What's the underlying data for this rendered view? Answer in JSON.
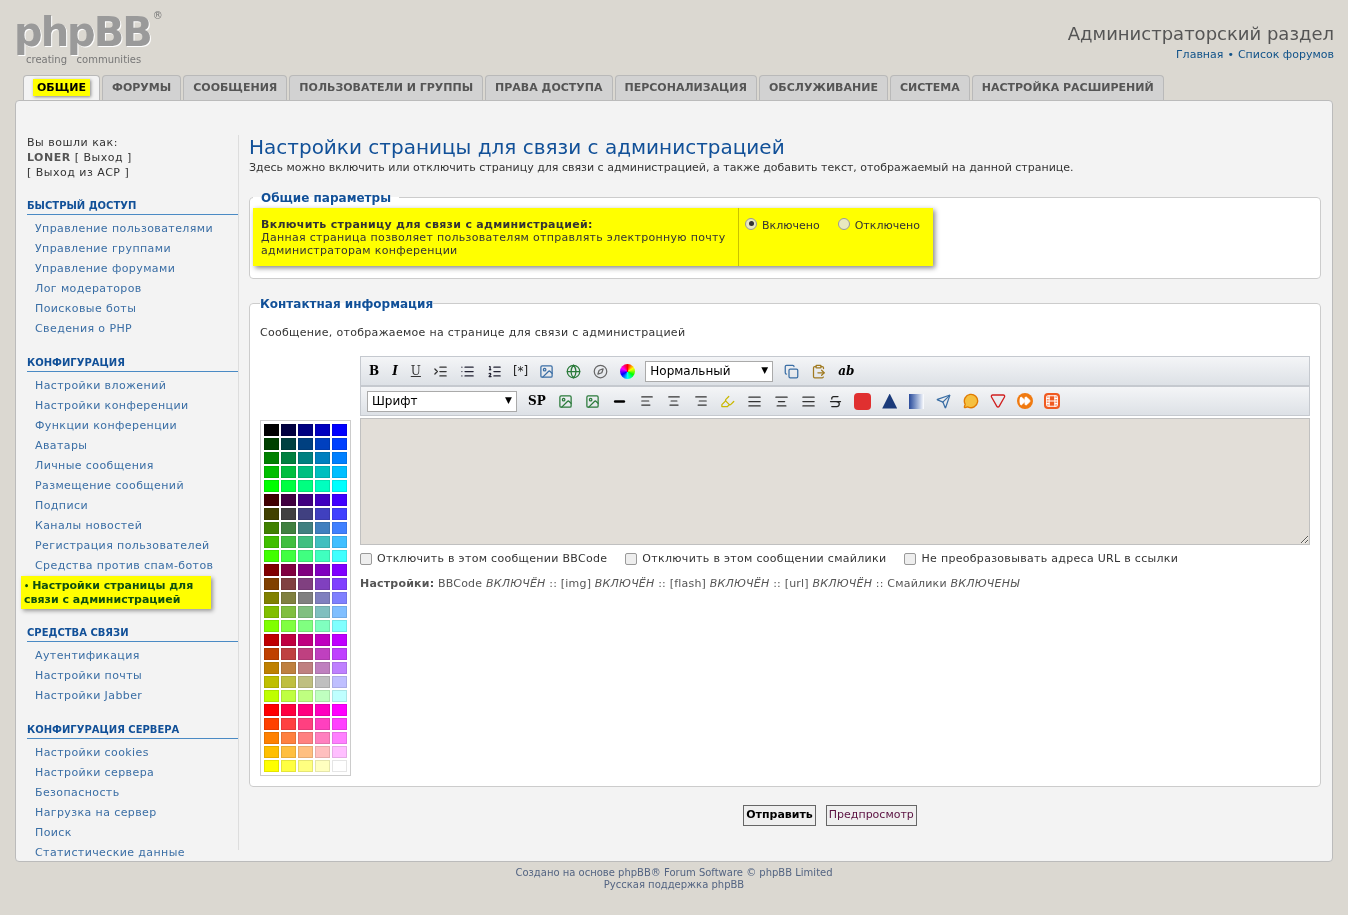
{
  "logo": {
    "name": "phpBB",
    "mark": "®",
    "tagline": "creating   communities"
  },
  "header": {
    "title": "Администраторский раздел",
    "links": [
      {
        "label": "Главная"
      },
      {
        "label": "Список форумов"
      }
    ],
    "separator": "•"
  },
  "tabs": [
    {
      "label": "ОБЩИЕ",
      "selected": true
    },
    {
      "label": "ФОРУМЫ",
      "selected": false
    },
    {
      "label": "СООБЩЕНИЯ",
      "selected": false
    },
    {
      "label": "ПОЛЬЗОВАТЕЛИ И ГРУППЫ",
      "selected": false
    },
    {
      "label": "ПРАВА ДОСТУПА",
      "selected": false
    },
    {
      "label": "ПЕРСОНАЛИЗАЦИЯ",
      "selected": false
    },
    {
      "label": "ОБСЛУЖИВАНИЕ",
      "selected": false
    },
    {
      "label": "СИСТЕМА",
      "selected": false
    },
    {
      "label": "НАСТРОЙКА РАСШИРЕНИЙ",
      "selected": false
    }
  ],
  "user": {
    "logged_in_as": "Вы вошли как:",
    "username": "LONER",
    "logout": "[ Выход ]",
    "acp_logout": "[ Выход из ACP ]"
  },
  "sidebar_marker": "•",
  "select_caret": "▼",
  "sidebar": [
    {
      "heading": "БЫСТРЫЙ ДОСТУП",
      "items": [
        {
          "label": "Управление пользователями",
          "selected": false
        },
        {
          "label": "Управление группами",
          "selected": false
        },
        {
          "label": "Управление форумами",
          "selected": false
        },
        {
          "label": "Лог модераторов",
          "selected": false
        },
        {
          "label": "Поисковые боты",
          "selected": false
        },
        {
          "label": "Сведения о PHP",
          "selected": false
        }
      ]
    },
    {
      "heading": "КОНФИГУРАЦИЯ",
      "items": [
        {
          "label": "Настройки вложений",
          "selected": false
        },
        {
          "label": "Настройки конференции",
          "selected": false
        },
        {
          "label": "Функции конференции",
          "selected": false
        },
        {
          "label": "Аватары",
          "selected": false
        },
        {
          "label": "Личные сообщения",
          "selected": false
        },
        {
          "label": "Размещение сообщений",
          "selected": false
        },
        {
          "label": "Подписи",
          "selected": false
        },
        {
          "label": "Каналы новостей",
          "selected": false
        },
        {
          "label": "Регистрация пользователей",
          "selected": false
        },
        {
          "label": "Средства против спам-ботов",
          "selected": false
        },
        {
          "label": "Настройки страницы для связи с администрацией",
          "selected": true
        }
      ]
    },
    {
      "heading": "СРЕДСТВА СВЯЗИ",
      "items": [
        {
          "label": "Аутентификация",
          "selected": false
        },
        {
          "label": "Настройки почты",
          "selected": false
        },
        {
          "label": "Настройки Jabber",
          "selected": false
        }
      ]
    },
    {
      "heading": "КОНФИГУРАЦИЯ СЕРВЕРА",
      "items": [
        {
          "label": "Настройки cookies",
          "selected": false
        },
        {
          "label": "Настройки сервера",
          "selected": false
        },
        {
          "label": "Безопасность",
          "selected": false
        },
        {
          "label": "Нагрузка на сервер",
          "selected": false
        },
        {
          "label": "Поиск",
          "selected": false
        },
        {
          "label": "Статистические данные",
          "selected": false
        }
      ]
    }
  ],
  "page": {
    "title": "Настройки страницы для связи с администрацией",
    "description": "Здесь можно включить или отключить страницу для связи с администрацией, а также добавить текст, отображаемый на данной странице."
  },
  "general": {
    "legend": "Общие параметры",
    "setting": {
      "label": "Включить страницу для связи с администрацией:",
      "explain": "Данная страница позволяет пользователям отправлять электронную почту администраторам конференции",
      "options": [
        {
          "label": "Включено",
          "selected": true
        },
        {
          "label": "Отключено",
          "selected": false
        }
      ]
    }
  },
  "contact": {
    "legend": "Контактная информация",
    "explain": "Сообщение, отображаемое на странице для связи с администрацией",
    "toolbar_1": [
      {
        "kind": "bold",
        "label": "B"
      },
      {
        "kind": "italic",
        "label": "I"
      },
      {
        "kind": "underline",
        "label": "U"
      },
      {
        "kind": "icon"
      },
      {
        "kind": "icon"
      },
      {
        "kind": "icon"
      },
      {
        "kind": "text",
        "label": "[*]"
      },
      {
        "kind": "icon"
      },
      {
        "kind": "icon"
      },
      {
        "kind": "icon"
      },
      {
        "kind": "icon"
      },
      {
        "kind": "select",
        "value": "Нормальный"
      },
      {
        "kind": "icon"
      },
      {
        "kind": "icon"
      },
      {
        "kind": "italic",
        "label": "ab"
      }
    ],
    "toolbar_2": [
      {
        "kind": "select",
        "value": "Шрифт"
      },
      {
        "kind": "bold",
        "label": "SP"
      },
      {
        "kind": "icon"
      },
      {
        "kind": "icon"
      },
      {
        "kind": "icon"
      },
      {
        "kind": "icon"
      },
      {
        "kind": "icon"
      },
      {
        "kind": "icon"
      },
      {
        "kind": "icon"
      },
      {
        "kind": "icon"
      },
      {
        "kind": "icon"
      },
      {
        "kind": "icon"
      },
      {
        "kind": "icon"
      },
      {
        "kind": "icon"
      },
      {
        "kind": "icon"
      },
      {
        "kind": "icon"
      },
      {
        "kind": "icon"
      },
      {
        "kind": "icon"
      },
      {
        "kind": "icon"
      },
      {
        "kind": "icon"
      },
      {
        "kind": "icon"
      }
    ],
    "options": [
      {
        "label": "Отключить в этом сообщении BBCode",
        "checked": false
      },
      {
        "label": "Отключить в этом сообщении смайлики",
        "checked": false
      },
      {
        "label": "Не преобразовывать адреса URL в ссылки",
        "checked": false
      }
    ],
    "status": "**Настройки:** BBCode *ВКЛЮЧЁН* :: [img] *ВКЛЮЧЁН* :: [flash] *ВКЛЮЧЁН* :: [url] *ВКЛЮЧЁН* :: Смайлики *ВКЛЮЧЕНЫ*"
  },
  "buttons": [
    {
      "label": "Отправить",
      "kind": "primary"
    },
    {
      "label": "Предпросмотр",
      "kind": "secondary"
    }
  ],
  "footer": [
    "Создано на основе phpBB® Forum Software © phpBB Limited",
    "Русская поддержка phpBB"
  ]
}
